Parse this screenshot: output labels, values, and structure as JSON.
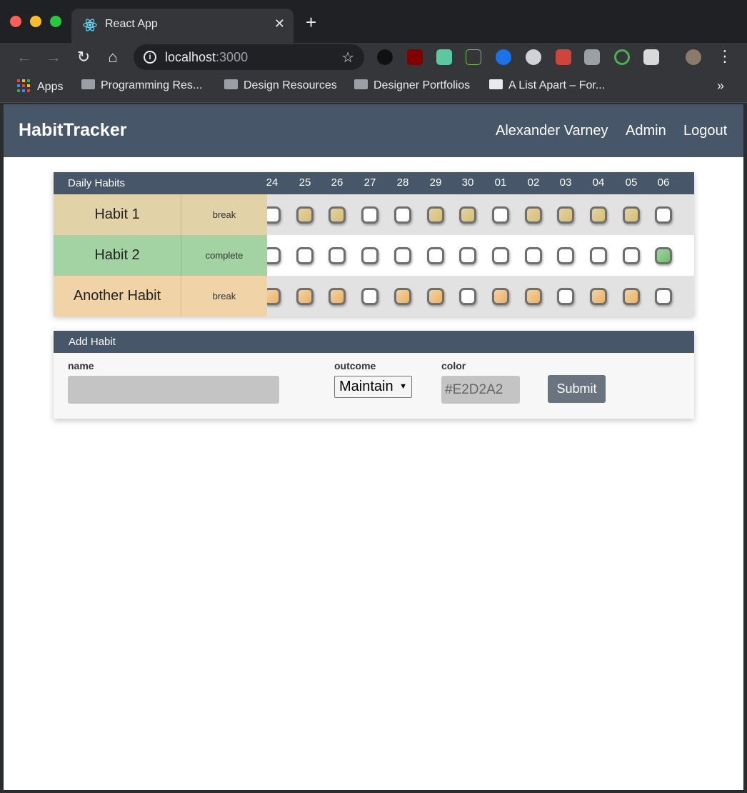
{
  "browser": {
    "tab_title": "React App",
    "tab_close": "✕",
    "new_tab": "+",
    "url_host": "localhost",
    "url_port": ":3000",
    "bookmarks": [
      "Apps",
      "Programming Res...",
      "Design Resources",
      "Designer Portfolios",
      "A List Apart – For..."
    ],
    "more_bookmarks": "»"
  },
  "nav": {
    "brand": "HabitTracker",
    "user": "Alexander Varney",
    "admin": "Admin",
    "logout": "Logout"
  },
  "habits_card": {
    "title": "Daily Habits",
    "days": [
      "24",
      "25",
      "26",
      "27",
      "28",
      "29",
      "30",
      "01",
      "02",
      "03",
      "04",
      "05",
      "06"
    ],
    "habits": [
      {
        "name": "Habit 1",
        "outcome": "break",
        "color": "#E1D2A8",
        "row_bg": "#e2e2e2",
        "fill": "#d9bd6f",
        "checks": [
          false,
          true,
          true,
          false,
          false,
          true,
          true,
          false,
          true,
          true,
          true,
          true,
          false
        ]
      },
      {
        "name": "Habit 2",
        "outcome": "complete",
        "color": "#A3D3A2",
        "row_bg": "#ffffff",
        "fill": "#6cbd6a",
        "checks": [
          false,
          false,
          false,
          false,
          false,
          false,
          false,
          false,
          false,
          false,
          false,
          false,
          true
        ]
      },
      {
        "name": "Another Habit",
        "outcome": "break",
        "color": "#F1D3A8",
        "row_bg": "#e2e2e2",
        "fill": "#efb162",
        "checks": [
          true,
          true,
          true,
          false,
          true,
          true,
          false,
          true,
          true,
          false,
          true,
          true,
          false
        ]
      }
    ]
  },
  "add_card": {
    "title": "Add Habit",
    "name_label": "name",
    "name_value": "",
    "outcome_label": "outcome",
    "outcome_value": "Maintain",
    "color_label": "color",
    "color_placeholder": "#E2D2A2",
    "submit": "Submit"
  }
}
